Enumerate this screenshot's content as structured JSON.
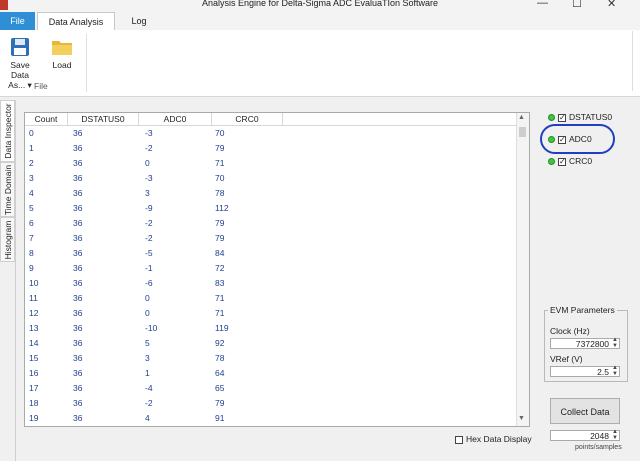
{
  "window": {
    "title": "Analysis Engine for Delta-Sigma ADC EvaluaTIon Software",
    "controls": {
      "minimize": "—",
      "maximize": "☐",
      "close": "✕"
    }
  },
  "tabs": {
    "file": "File",
    "data_analysis": "Data Analysis",
    "log": "Log"
  },
  "ribbon": {
    "save_label_1": "Save Data",
    "save_label_2": "As... ▾",
    "load_label": "Load",
    "group_label": "File"
  },
  "side_tabs": {
    "data_inspector": "Data Inspector",
    "time_domain": "Time Domain",
    "histogram": "Histogram"
  },
  "table": {
    "columns": [
      "Count",
      "DSTATUS0",
      "ADC0",
      "CRC0"
    ],
    "rows": [
      [
        "0",
        "36",
        "-3",
        "70"
      ],
      [
        "1",
        "36",
        "-2",
        "79"
      ],
      [
        "2",
        "36",
        "0",
        "71"
      ],
      [
        "3",
        "36",
        "-3",
        "70"
      ],
      [
        "4",
        "36",
        "3",
        "78"
      ],
      [
        "5",
        "36",
        "-9",
        "112"
      ],
      [
        "6",
        "36",
        "-2",
        "79"
      ],
      [
        "7",
        "36",
        "-2",
        "79"
      ],
      [
        "8",
        "36",
        "-5",
        "84"
      ],
      [
        "9",
        "36",
        "-1",
        "72"
      ],
      [
        "10",
        "36",
        "-6",
        "83"
      ],
      [
        "11",
        "36",
        "0",
        "71"
      ],
      [
        "12",
        "36",
        "0",
        "71"
      ],
      [
        "13",
        "36",
        "-10",
        "119"
      ],
      [
        "14",
        "36",
        "5",
        "92"
      ],
      [
        "15",
        "36",
        "3",
        "78"
      ],
      [
        "16",
        "36",
        "1",
        "64"
      ],
      [
        "17",
        "36",
        "-4",
        "65"
      ],
      [
        "18",
        "36",
        "-2",
        "79"
      ],
      [
        "19",
        "36",
        "4",
        "91"
      ]
    ]
  },
  "hex_display": "Hex Data Display",
  "channels": [
    {
      "name": "DSTATUS0",
      "checked": true
    },
    {
      "name": "ADC0",
      "checked": true
    },
    {
      "name": "CRC0",
      "checked": true
    }
  ],
  "evm": {
    "title": "EVM Parameters",
    "clock_label": "Clock (Hz)",
    "clock_value": "7372800",
    "vref_label": "VRef (V)",
    "vref_value": "2.5"
  },
  "collect": {
    "label": "Collect Data",
    "samples": "2048",
    "samples_unit": "points/samples"
  },
  "colors": {
    "accent": "#2e8fd6",
    "annotation": "#1f3fbf",
    "status_green": "#3cc93c"
  }
}
